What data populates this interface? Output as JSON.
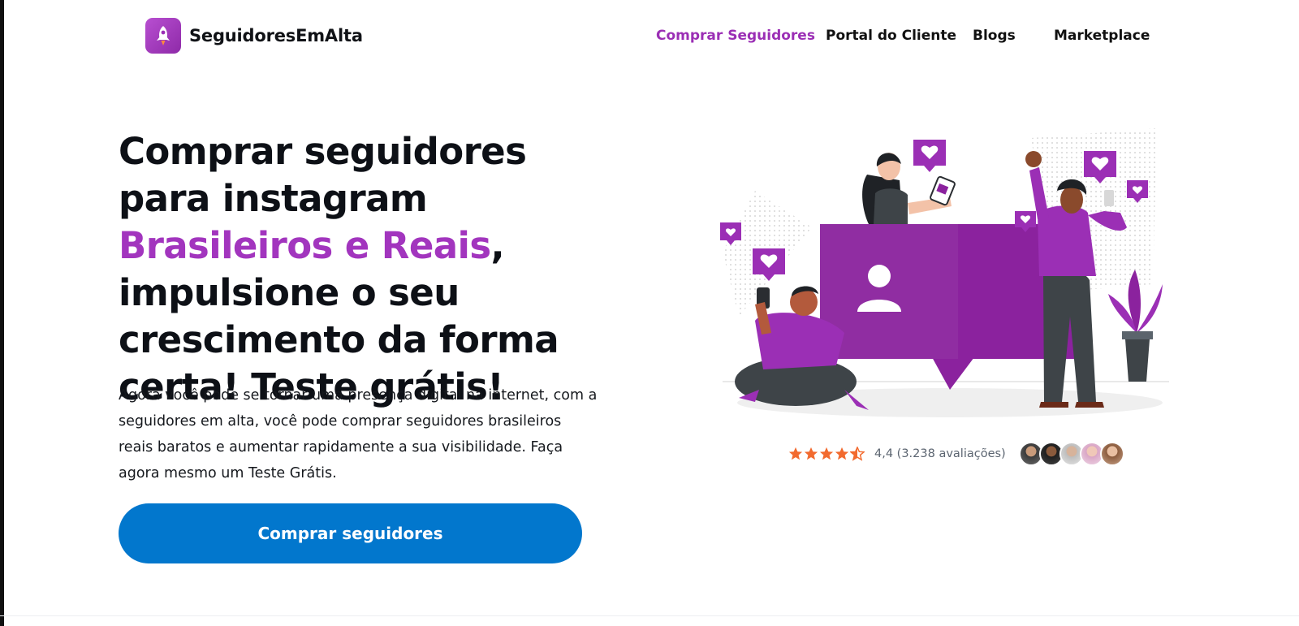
{
  "header": {
    "logo_text": "SeguidoresEmAlta",
    "logo_icon": "rocket-icon",
    "nav": [
      {
        "label": "Comprar Seguidores",
        "active": true
      },
      {
        "label": "Portal do Cliente",
        "active": false
      },
      {
        "label": "Blogs",
        "active": false
      },
      {
        "label": "Marketplace",
        "active": false
      }
    ]
  },
  "hero": {
    "title_part1": "Comprar seguidores para instagram ",
    "title_highlight": "Brasileiros e Reais",
    "title_part2": ", impulsione o seu crescimento da forma certa! Teste grátis!",
    "description": "Agora você pode se tornar uma presença digital na internet, com a seguidores em alta, você pode comprar seguidores brasileiros reais baratos e aumentar rapidamente a sua visibilidade. Faça agora mesmo um Teste Grátis.",
    "cta_label": "Comprar seguidores"
  },
  "rating": {
    "stars": 4.5,
    "text": "4,4 (3.238 avaliações)",
    "avatar_count": 5
  },
  "colors": {
    "brand_purple": "#a235be",
    "cta_blue": "#0277cd",
    "star_orange": "#f26a2e"
  }
}
